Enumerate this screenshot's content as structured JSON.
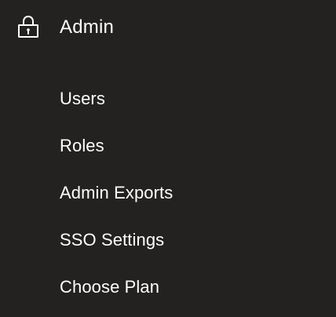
{
  "nav": {
    "section": {
      "title": "Admin",
      "icon": "lock-icon"
    },
    "items": [
      {
        "label": "Users"
      },
      {
        "label": "Roles"
      },
      {
        "label": "Admin Exports"
      },
      {
        "label": "SSO Settings"
      },
      {
        "label": "Choose Plan"
      }
    ]
  },
  "colors": {
    "background": "#232221",
    "text": "#ffffff"
  }
}
